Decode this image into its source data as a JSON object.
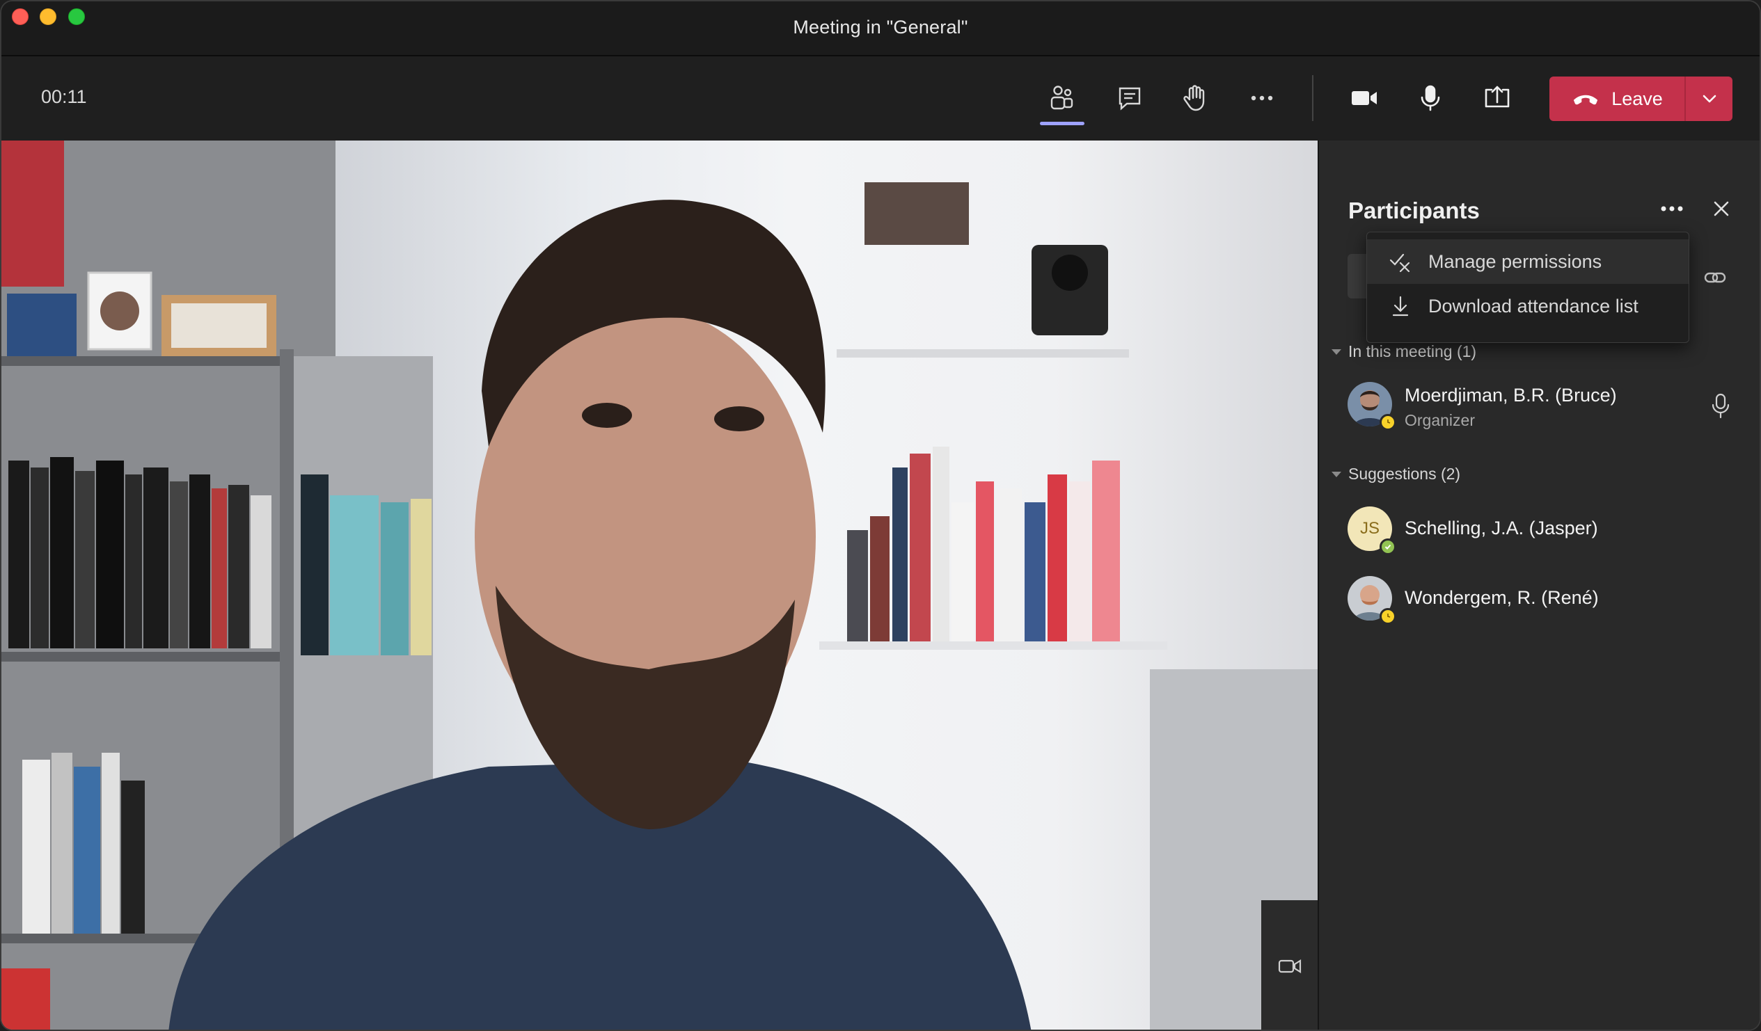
{
  "window": {
    "title": "Meeting in \"General\""
  },
  "toolbar": {
    "timer": "00:11",
    "leave_label": "Leave",
    "accent_color": "#9ea2ff",
    "leave_color": "#c4314b"
  },
  "icons": {
    "participants": "people-icon",
    "chat": "chat-icon",
    "raise_hand": "hand-icon",
    "more": "more-icon",
    "camera": "video-camera-icon",
    "mic": "microphone-icon",
    "share": "share-screen-icon",
    "leave": "phone-hangup-icon",
    "dropdown": "chevron-down-icon"
  },
  "panel": {
    "title": "Participants",
    "sections": {
      "in_meeting": "In this meeting (1)",
      "suggestions": "Suggestions (2)"
    },
    "in_meeting": [
      {
        "name": "Moerdjiman, B.R. (Bruce)",
        "role": "Organizer",
        "presence": "away",
        "presence_color": "#f8d22a"
      }
    ],
    "suggestions": [
      {
        "name": "Schelling, J.A. (Jasper)",
        "initials": "JS",
        "presence": "available",
        "presence_color": "#92c353",
        "avatar_color": "#f2e6b8"
      },
      {
        "name": "Wondergem, R. (René)",
        "presence": "away",
        "presence_color": "#f8d22a"
      }
    ]
  },
  "menu": {
    "items": [
      {
        "label": "Manage permissions",
        "icon": "manage-permissions-icon"
      },
      {
        "label": "Download attendance list",
        "icon": "download-icon"
      }
    ]
  }
}
